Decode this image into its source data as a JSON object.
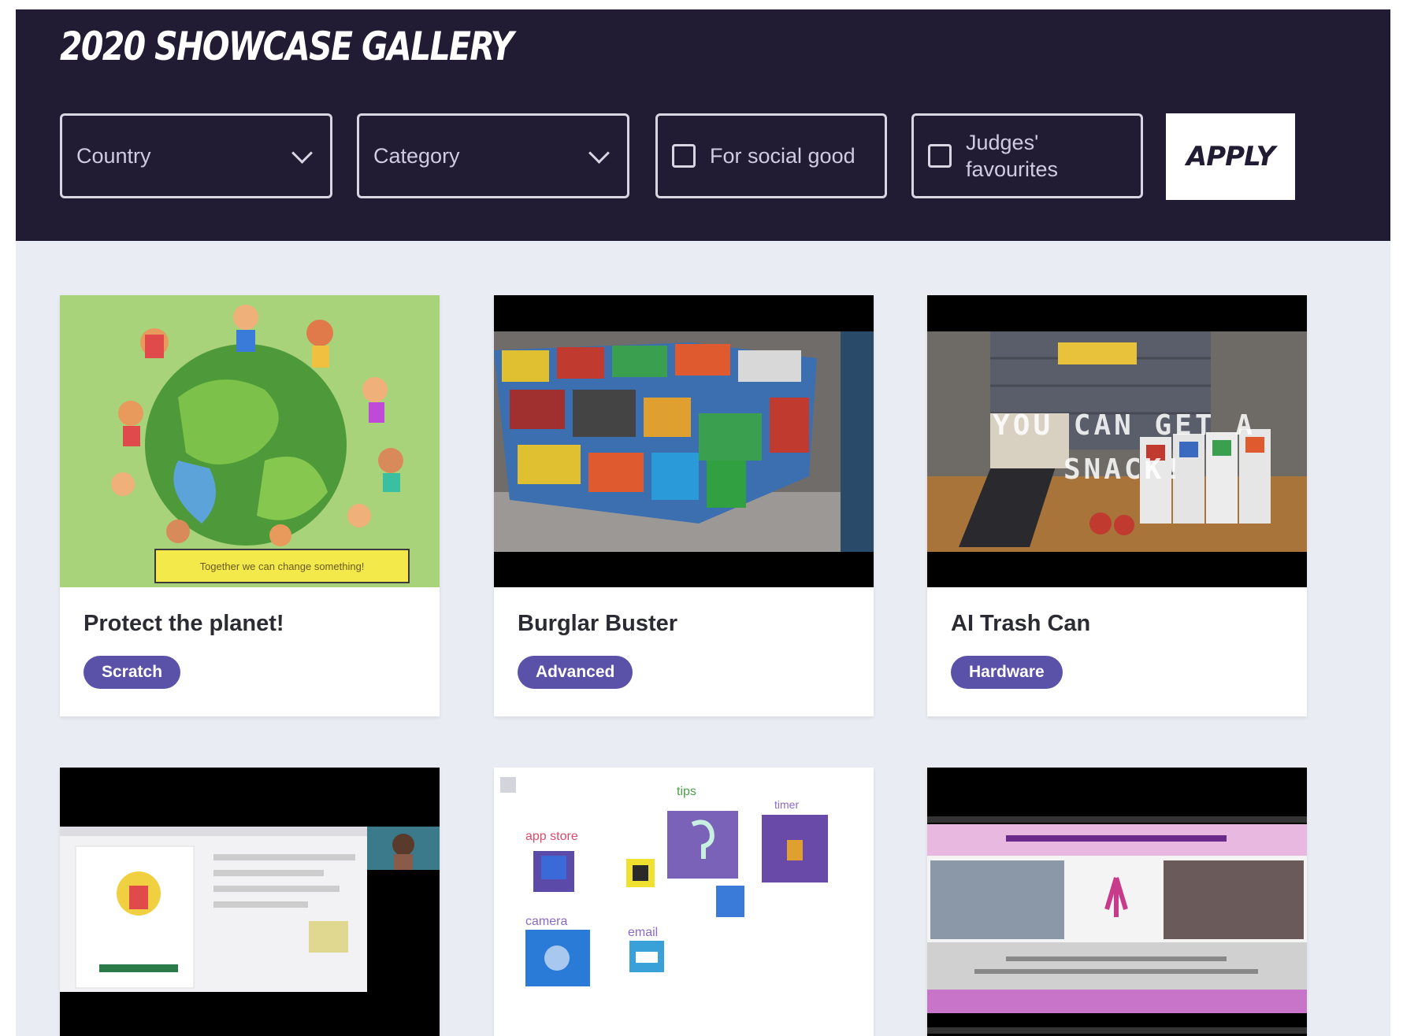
{
  "header": {
    "title": "2020 SHOWCASE GALLERY",
    "filters": {
      "country_label": "Country",
      "category_label": "Category",
      "social_good_label": "For social good",
      "judges_label": "Judges' favourites"
    },
    "apply_label": "APPLY"
  },
  "cards": [
    {
      "title": "Protect the planet!",
      "tag": "Scratch",
      "caption": "Together we can change something!"
    },
    {
      "title": "Burglar Buster",
      "tag": "Advanced"
    },
    {
      "title": "AI Trash Can",
      "tag": "Hardware",
      "overlay": "YOU CAN GET A SNACK!"
    },
    {
      "title": ""
    },
    {
      "title": "",
      "labels": {
        "tips": "tips",
        "app_store": "app store",
        "timer": "timer",
        "camera": "camera",
        "email": "email"
      }
    },
    {
      "title": ""
    }
  ],
  "colors": {
    "header_bg": "#211b33",
    "page_bg": "#e9ecf2",
    "tag_bg": "#5a51a8"
  }
}
